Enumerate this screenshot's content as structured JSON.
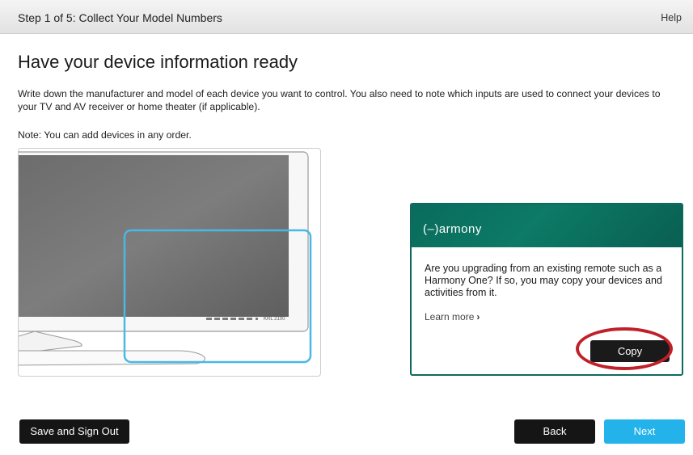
{
  "header": {
    "step_title": "Step 1 of 5: Collect Your Model Numbers",
    "help_label": "Help"
  },
  "main": {
    "title": "Have your device information ready",
    "intro": "Write down the manufacturer and model of each device you want to control. You also need to note which inputs are used to connect your devices to your TV and AV receiver or home theater (if applicable).",
    "note": "Note: You can add devices in any order."
  },
  "illustration": {
    "model_label": "KRL 2100",
    "highlight_color": "#49b8e6"
  },
  "card": {
    "brand": "(–)armony",
    "message": "Are you upgrading from an existing remote such as a Harmony One? If so, you may copy your devices and activities from it.",
    "learn_more": "Learn more",
    "learn_more_icon": "chevron-right-icon",
    "copy_label": "Copy",
    "header_color": "#0a6b5c",
    "highlight_ring_color": "#c0202a"
  },
  "footer": {
    "save_label": "Save and Sign Out",
    "back_label": "Back",
    "next_label": "Next",
    "next_color": "#23b2ea"
  }
}
